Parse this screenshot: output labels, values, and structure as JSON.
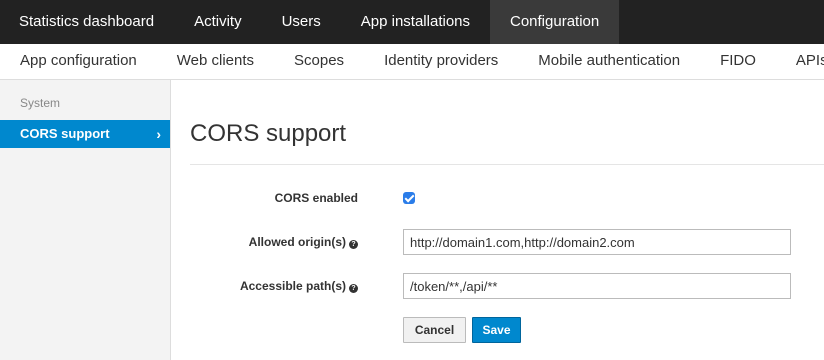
{
  "top_nav": {
    "tabs": [
      {
        "label": "Statistics dashboard"
      },
      {
        "label": "Activity"
      },
      {
        "label": "Users"
      },
      {
        "label": "App installations"
      },
      {
        "label": "Configuration"
      }
    ],
    "active_tab": "Configuration"
  },
  "sub_nav": {
    "items": [
      {
        "label": "App configuration"
      },
      {
        "label": "Web clients"
      },
      {
        "label": "Scopes"
      },
      {
        "label": "Identity providers"
      },
      {
        "label": "Mobile authentication"
      },
      {
        "label": "FIDO"
      },
      {
        "label": "APIs"
      }
    ]
  },
  "sidebar": {
    "section_label": "System",
    "active_item": {
      "label": "CORS support",
      "chevron": "›"
    }
  },
  "main": {
    "title": "CORS support",
    "form": {
      "cors_enabled": {
        "label": "CORS enabled",
        "checked": true
      },
      "allowed_origins": {
        "label": "Allowed origin(s)",
        "help_icon": "question-circle-icon",
        "value": "http://domain1.com,http://domain2.com"
      },
      "accessible_paths": {
        "label": "Accessible path(s)",
        "help_icon": "question-circle-icon",
        "value": "/token/**,/api/**"
      },
      "cancel_label": "Cancel",
      "save_label": "Save"
    }
  },
  "colors": {
    "topbar_bg": "#222222",
    "topbar_active_bg": "#3a3a3a",
    "accent": "#0088ce",
    "checkbox": "#2b7de9"
  }
}
